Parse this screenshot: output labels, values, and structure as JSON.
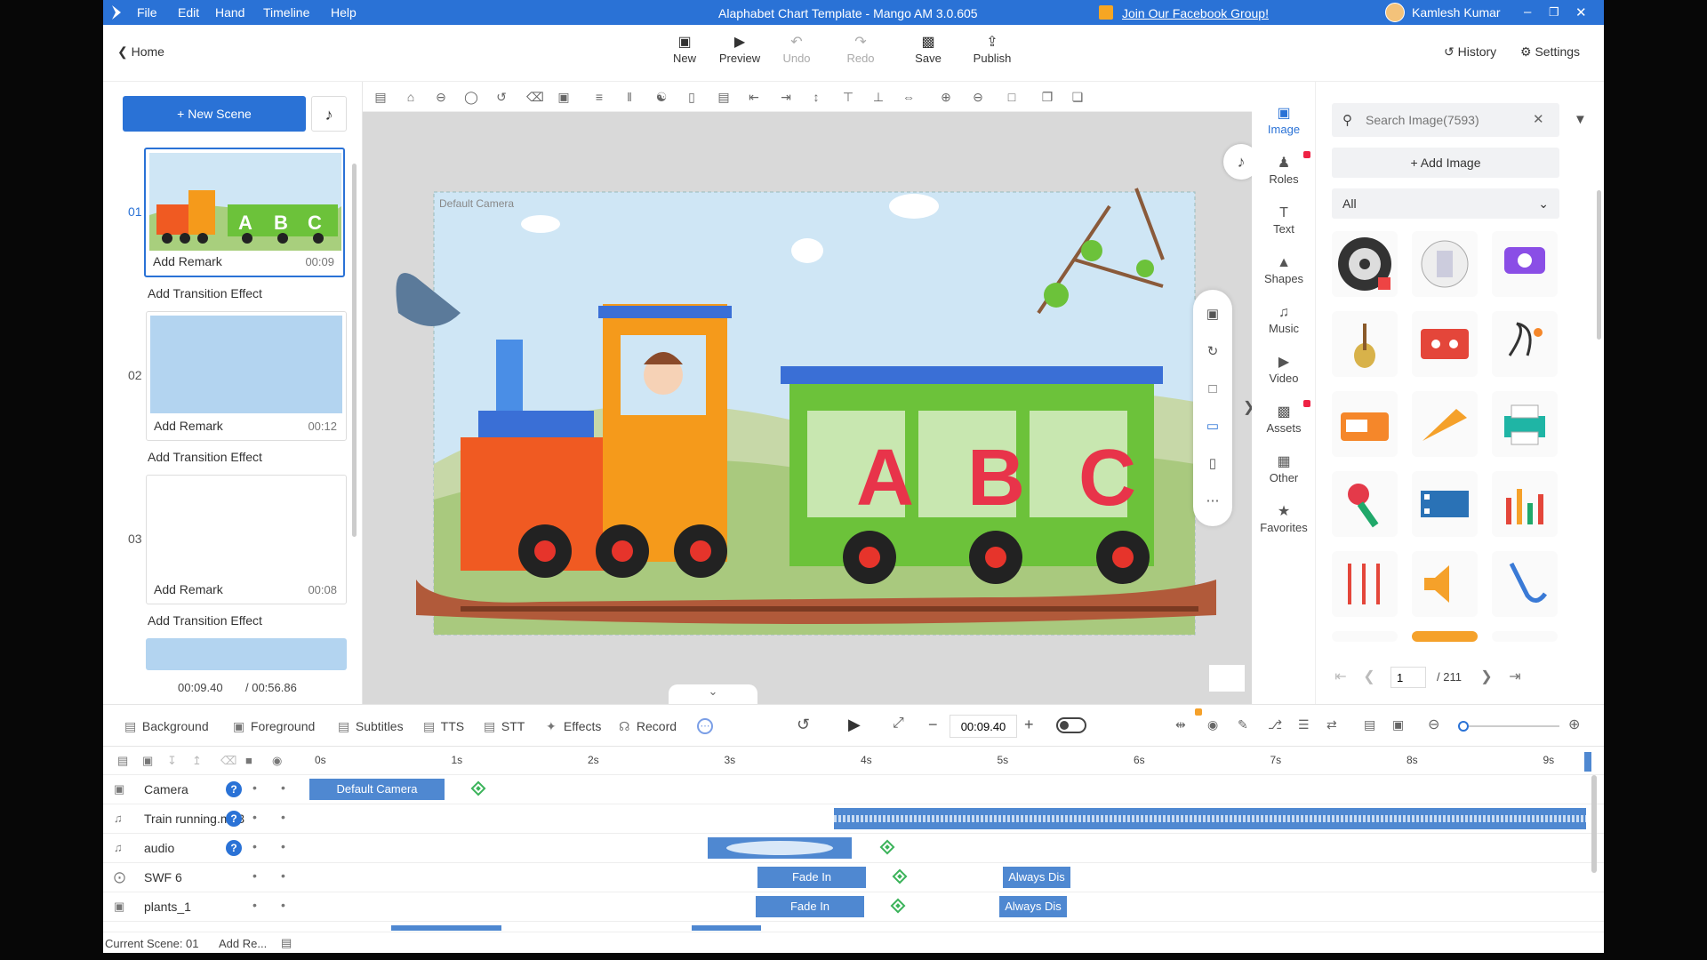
{
  "menubar": {
    "menus": [
      "File",
      "Edit",
      "Hand",
      "Timeline",
      "Help"
    ],
    "title": "Alaphabet Chart Template - Mango AM 3.0.605",
    "facebook": "Join Our Facebook Group!",
    "user": "Kamlesh Kumar"
  },
  "toolbar": {
    "home": "Home",
    "new": "New",
    "preview": "Preview",
    "undo": "Undo",
    "redo": "Redo",
    "save": "Save",
    "publish": "Publish",
    "history": "History",
    "settings": "Settings"
  },
  "scenes": {
    "new_scene": "New Scene",
    "items": [
      {
        "num": "01",
        "remark": "Add Remark",
        "time": "00:09"
      },
      {
        "num": "02",
        "remark": "Add Remark",
        "time": "00:12"
      },
      {
        "num": "03",
        "remark": "Add Remark",
        "time": "00:08"
      }
    ],
    "transition": "Add Transition Effect",
    "current_time": "00:09.40",
    "total_time": "/ 00:56.86"
  },
  "canvas": {
    "camera_label": "Default Camera",
    "letters": [
      "A",
      "B",
      "C"
    ]
  },
  "categories": [
    "Image",
    "Roles",
    "Text",
    "Shapes",
    "Music",
    "Video",
    "Assets",
    "Other",
    "Favorites"
  ],
  "rightpanel": {
    "search_placeholder": "Search Image(7593)",
    "add_image": "Add Image",
    "filter": "All",
    "page": "1",
    "total_pages": "/ 211"
  },
  "bottombar": {
    "tabs": [
      "Background",
      "Foreground",
      "Subtitles",
      "TTS",
      "STT",
      "Effects",
      "Record"
    ],
    "time": "00:09.40"
  },
  "timeline": {
    "ticks": [
      "0s",
      "1s",
      "2s",
      "3s",
      "4s",
      "5s",
      "6s",
      "7s",
      "8s",
      "9s"
    ],
    "tracks": [
      {
        "name": "Camera"
      },
      {
        "name": "Train running.mp3"
      },
      {
        "name": "audio"
      },
      {
        "name": "SWF 6"
      },
      {
        "name": "plants_1"
      }
    ],
    "clip_camera": "Default Camera",
    "clip_fadein": "Fade In",
    "clip_always": "Always Dis"
  },
  "status": {
    "current_scene": "Current Scene: 01",
    "add_remark": "Add Re..."
  },
  "colors": {
    "accent": "#2a72d6",
    "train_green": "#6cc23a",
    "train_orange": "#f59a1b",
    "train_red": "#f05a22"
  }
}
